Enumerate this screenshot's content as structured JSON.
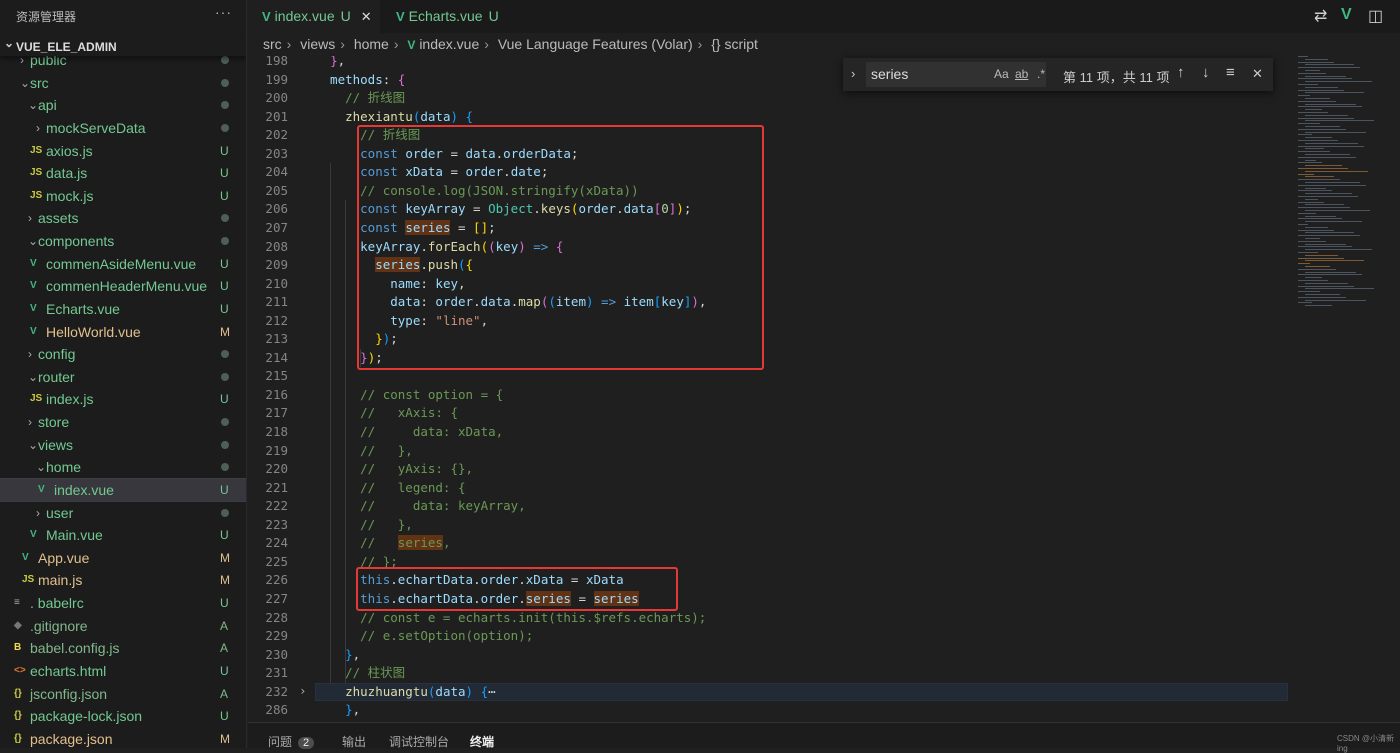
{
  "sidebar": {
    "title": "资源管理器",
    "more": "···",
    "root": "VUE_ELE_ADMIN",
    "items": [
      {
        "name": "public",
        "depth": 1,
        "type": "folder",
        "open": false,
        "status": "dot",
        "color": "#73c991"
      },
      {
        "name": "src",
        "depth": 1,
        "type": "folder",
        "open": true,
        "status": "dot",
        "color": "#73c991"
      },
      {
        "name": "api",
        "depth": 2,
        "type": "folder",
        "open": true,
        "status": "dot",
        "color": "#73c991"
      },
      {
        "name": "mockServeData",
        "depth": 3,
        "type": "folder",
        "open": false,
        "status": "dot",
        "color": "#73c991"
      },
      {
        "name": "axios.js",
        "depth": 3,
        "type": "js",
        "status": "U",
        "color": "#73c991"
      },
      {
        "name": "data.js",
        "depth": 3,
        "type": "js",
        "status": "U",
        "color": "#73c991"
      },
      {
        "name": "mock.js",
        "depth": 3,
        "type": "js",
        "status": "U",
        "color": "#73c991"
      },
      {
        "name": "assets",
        "depth": 2,
        "type": "folder",
        "open": false,
        "status": "dot",
        "color": "#73c991"
      },
      {
        "name": "components",
        "depth": 2,
        "type": "folder",
        "open": true,
        "status": "dot",
        "color": "#73c991"
      },
      {
        "name": "commenAsideMenu.vue",
        "depth": 3,
        "type": "vue",
        "status": "U",
        "color": "#73c991"
      },
      {
        "name": "commenHeaderMenu.vue",
        "depth": 3,
        "type": "vue",
        "status": "U",
        "color": "#73c991"
      },
      {
        "name": "Echarts.vue",
        "depth": 3,
        "type": "vue",
        "status": "U",
        "color": "#73c991"
      },
      {
        "name": "HelloWorld.vue",
        "depth": 3,
        "type": "vue",
        "status": "M",
        "color": "#e2c08d"
      },
      {
        "name": "config",
        "depth": 2,
        "type": "folder",
        "open": false,
        "status": "dot",
        "color": "#73c991"
      },
      {
        "name": "router",
        "depth": 2,
        "type": "folder",
        "open": true,
        "status": "dot",
        "color": "#73c991"
      },
      {
        "name": "index.js",
        "depth": 3,
        "type": "js",
        "status": "U",
        "color": "#73c991"
      },
      {
        "name": "store",
        "depth": 2,
        "type": "folder",
        "open": false,
        "status": "dot",
        "color": "#73c991"
      },
      {
        "name": "views",
        "depth": 2,
        "type": "folder",
        "open": true,
        "status": "dot",
        "color": "#73c991"
      },
      {
        "name": "home",
        "depth": 3,
        "type": "folder",
        "open": true,
        "status": "dot",
        "color": "#73c991"
      },
      {
        "name": "index.vue",
        "depth": 4,
        "type": "vue",
        "status": "U",
        "color": "#73c991",
        "selected": true
      },
      {
        "name": "user",
        "depth": 3,
        "type": "folder",
        "open": false,
        "status": "dot",
        "color": "#73c991"
      },
      {
        "name": "Main.vue",
        "depth": 3,
        "type": "vue",
        "status": "U",
        "color": "#73c991"
      },
      {
        "name": "App.vue",
        "depth": 2,
        "type": "vue",
        "status": "M",
        "color": "#e2c08d"
      },
      {
        "name": "main.js",
        "depth": 2,
        "type": "js",
        "status": "M",
        "color": "#e2c08d"
      },
      {
        "name": ". babelrc",
        "depth": 1,
        "type": "lines",
        "status": "U",
        "color": "#73c991"
      },
      {
        "name": ".gitignore",
        "depth": 1,
        "type": "git",
        "status": "A",
        "color": "#81b88b"
      },
      {
        "name": "babel.config.js",
        "depth": 1,
        "type": "babel",
        "status": "A",
        "color": "#81b88b"
      },
      {
        "name": "echarts.html",
        "depth": 1,
        "type": "html",
        "status": "U",
        "color": "#73c991"
      },
      {
        "name": "jsconfig.json",
        "depth": 1,
        "type": "json",
        "status": "A",
        "color": "#81b88b"
      },
      {
        "name": "package-lock.json",
        "depth": 1,
        "type": "json",
        "status": "U",
        "color": "#73c991"
      },
      {
        "name": "package.json",
        "depth": 1,
        "type": "json",
        "status": "M",
        "color": "#e2c08d"
      }
    ]
  },
  "tabs": [
    {
      "label": "index.vue",
      "status": "U",
      "active": true,
      "close": "✕"
    },
    {
      "label": "Echarts.vue",
      "status": "U",
      "active": false
    }
  ],
  "breadcrumb": [
    "src",
    "views",
    "home",
    "index.vue",
    "Vue Language Features (Volar)",
    "{} script"
  ],
  "find": {
    "value": "series",
    "case": "Aa",
    "word": "ab",
    "regex": ".*",
    "count": "第 11 项，共 11 项"
  },
  "code": [
    {
      "n": "198",
      "t": [
        [
          "  ",
          ""
        ],
        [
          "}",
          "pu"
        ],
        [
          ",",
          "p"
        ]
      ]
    },
    {
      "n": "199",
      "t": [
        [
          "  methods",
          "v"
        ],
        [
          ": ",
          "p"
        ],
        [
          "{",
          "pu"
        ]
      ]
    },
    {
      "n": "200",
      "t": [
        [
          "    // 折线图",
          "c"
        ]
      ]
    },
    {
      "n": "201",
      "t": [
        [
          "    zhexiantu",
          "f"
        ],
        [
          "(",
          "b"
        ],
        [
          "data",
          "v"
        ],
        [
          ") ",
          "b"
        ],
        [
          "{",
          "b"
        ]
      ]
    },
    {
      "n": "202",
      "t": [
        [
          "      // 折线图",
          "c"
        ]
      ]
    },
    {
      "n": "203",
      "t": [
        [
          "      const ",
          "k"
        ],
        [
          "order",
          "v"
        ],
        [
          " = ",
          "p"
        ],
        [
          "data",
          "v"
        ],
        [
          ".",
          "p"
        ],
        [
          "orderData",
          "v"
        ],
        [
          ";",
          "p"
        ]
      ]
    },
    {
      "n": "204",
      "t": [
        [
          "      const ",
          "k"
        ],
        [
          "xData",
          "v"
        ],
        [
          " = ",
          "p"
        ],
        [
          "order",
          "v"
        ],
        [
          ".",
          "p"
        ],
        [
          "date",
          "v"
        ],
        [
          ";",
          "p"
        ]
      ]
    },
    {
      "n": "205",
      "t": [
        [
          "      // console.log(JSON.stringify(xData))",
          "c"
        ]
      ]
    },
    {
      "n": "206",
      "t": [
        [
          "      const ",
          "k"
        ],
        [
          "keyArray",
          "v"
        ],
        [
          " = ",
          "p"
        ],
        [
          "Object",
          "o"
        ],
        [
          ".",
          "p"
        ],
        [
          "keys",
          "f"
        ],
        [
          "(",
          "y"
        ],
        [
          "order",
          "v"
        ],
        [
          ".",
          "p"
        ],
        [
          "data",
          "v"
        ],
        [
          "[",
          "pu"
        ],
        [
          "0",
          "n"
        ],
        [
          "]",
          "pu"
        ],
        [
          ")",
          "y"
        ],
        [
          ";",
          "p"
        ]
      ]
    },
    {
      "n": "207",
      "t": [
        [
          "      const ",
          "k"
        ],
        [
          "series",
          "v m"
        ],
        [
          " = ",
          "p"
        ],
        [
          "[]",
          "y"
        ],
        [
          ";",
          "p"
        ]
      ]
    },
    {
      "n": "208",
      "t": [
        [
          "      keyArray",
          "v"
        ],
        [
          ".",
          "p"
        ],
        [
          "forEach",
          "f"
        ],
        [
          "(",
          "y"
        ],
        [
          "(",
          "pu"
        ],
        [
          "key",
          "v"
        ],
        [
          ")",
          "pu"
        ],
        [
          " => ",
          "k"
        ],
        [
          "{",
          "pu"
        ]
      ]
    },
    {
      "n": "209",
      "t": [
        [
          "        ",
          ""
        ],
        [
          "series",
          "v m"
        ],
        [
          ".",
          "p"
        ],
        [
          "push",
          "f"
        ],
        [
          "(",
          "b"
        ],
        [
          "{",
          "y"
        ]
      ]
    },
    {
      "n": "210",
      "t": [
        [
          "          name",
          "v"
        ],
        [
          ": ",
          "p"
        ],
        [
          "key",
          "v"
        ],
        [
          ",",
          "p"
        ]
      ]
    },
    {
      "n": "211",
      "t": [
        [
          "          data",
          "v"
        ],
        [
          ": ",
          "p"
        ],
        [
          "order",
          "v"
        ],
        [
          ".",
          "p"
        ],
        [
          "data",
          "v"
        ],
        [
          ".",
          "p"
        ],
        [
          "map",
          "f"
        ],
        [
          "(",
          "pu"
        ],
        [
          "(",
          "b"
        ],
        [
          "item",
          "v"
        ],
        [
          ")",
          "b"
        ],
        [
          " => ",
          "k"
        ],
        [
          "item",
          "v"
        ],
        [
          "[",
          "b"
        ],
        [
          "key",
          "v"
        ],
        [
          "]",
          "b"
        ],
        [
          ")",
          "pu"
        ],
        [
          ",",
          "p"
        ]
      ]
    },
    {
      "n": "212",
      "t": [
        [
          "          type",
          "v"
        ],
        [
          ": ",
          "p"
        ],
        [
          "\"line\"",
          "s"
        ],
        [
          ",",
          "p"
        ]
      ]
    },
    {
      "n": "213",
      "t": [
        [
          "        ",
          ""
        ],
        [
          "}",
          "y"
        ],
        [
          ")",
          "b"
        ],
        [
          ";",
          "p"
        ]
      ]
    },
    {
      "n": "214",
      "t": [
        [
          "      ",
          ""
        ],
        [
          "}",
          "pu"
        ],
        [
          ")",
          "y"
        ],
        [
          ";",
          "p"
        ]
      ]
    },
    {
      "n": "215",
      "t": []
    },
    {
      "n": "216",
      "t": [
        [
          "      // const option = {",
          "c"
        ]
      ]
    },
    {
      "n": "217",
      "t": [
        [
          "      //   xAxis: {",
          "c"
        ]
      ]
    },
    {
      "n": "218",
      "t": [
        [
          "      //     data: xData,",
          "c"
        ]
      ]
    },
    {
      "n": "219",
      "t": [
        [
          "      //   },",
          "c"
        ]
      ]
    },
    {
      "n": "220",
      "t": [
        [
          "      //   yAxis: {},",
          "c"
        ]
      ]
    },
    {
      "n": "221",
      "t": [
        [
          "      //   legend: {",
          "c"
        ]
      ]
    },
    {
      "n": "222",
      "t": [
        [
          "      //     data: keyArray,",
          "c"
        ]
      ]
    },
    {
      "n": "223",
      "t": [
        [
          "      //   },",
          "c"
        ]
      ]
    },
    {
      "n": "224",
      "t": [
        [
          "      //   ",
          "c"
        ],
        [
          "series",
          "c m"
        ],
        [
          ",",
          "c"
        ]
      ]
    },
    {
      "n": "225",
      "t": [
        [
          "      // };",
          "c"
        ]
      ]
    },
    {
      "n": "226",
      "t": [
        [
          "      this",
          "k"
        ],
        [
          ".",
          "p"
        ],
        [
          "echartData",
          "v"
        ],
        [
          ".",
          "p"
        ],
        [
          "order",
          "v"
        ],
        [
          ".",
          "p"
        ],
        [
          "xData",
          "v"
        ],
        [
          " = ",
          "p"
        ],
        [
          "xData",
          "v"
        ]
      ]
    },
    {
      "n": "227",
      "t": [
        [
          "      this",
          "k"
        ],
        [
          ".",
          "p"
        ],
        [
          "echartData",
          "v"
        ],
        [
          ".",
          "p"
        ],
        [
          "order",
          "v"
        ],
        [
          ".",
          "p"
        ],
        [
          "series",
          "v m"
        ],
        [
          " = ",
          "p"
        ],
        [
          "series",
          "v m"
        ]
      ]
    },
    {
      "n": "228",
      "t": [
        [
          "      // const e = echarts.init(this.$refs.echarts);",
          "c"
        ]
      ]
    },
    {
      "n": "229",
      "t": [
        [
          "      // e.setOption(option);",
          "c"
        ]
      ]
    },
    {
      "n": "230",
      "t": [
        [
          "    ",
          ""
        ],
        [
          "}",
          "b"
        ],
        [
          ",",
          "p"
        ]
      ]
    },
    {
      "n": "231",
      "t": [
        [
          "    // 柱状图",
          "c"
        ]
      ]
    },
    {
      "n": "232",
      "t": [
        [
          "    zhuzhuangtu",
          "f"
        ],
        [
          "(",
          "b"
        ],
        [
          "data",
          "v"
        ],
        [
          ") ",
          "b"
        ],
        [
          "{",
          "b"
        ],
        [
          "⋯",
          "p"
        ]
      ],
      "folded": true,
      "current": true
    },
    {
      "n": "286",
      "t": [
        [
          "    ",
          ""
        ],
        [
          "}",
          "b"
        ],
        [
          ",",
          "p"
        ]
      ]
    }
  ],
  "panel": {
    "tabs": [
      "问题",
      "输出",
      "调试控制台",
      "终端"
    ],
    "problems_count": "2",
    "active": "终端"
  },
  "watermark": "CSDN @小清新ing"
}
